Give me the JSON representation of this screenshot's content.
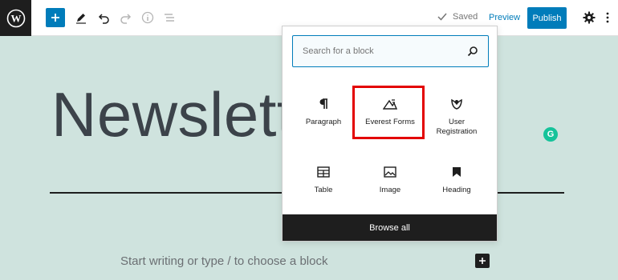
{
  "toolbar": {
    "saved_label": "Saved",
    "preview_label": "Preview",
    "publish_label": "Publish"
  },
  "editor": {
    "title": "Newslette",
    "placeholder": "Start writing or type / to choose a block"
  },
  "inserter": {
    "search_placeholder": "Search for a block",
    "blocks": [
      {
        "label": "Paragraph",
        "icon": "paragraph-icon"
      },
      {
        "label": "Everest Forms",
        "icon": "everest-forms-icon"
      },
      {
        "label": "User Registration",
        "icon": "user-registration-icon"
      },
      {
        "label": "Table",
        "icon": "table-icon"
      },
      {
        "label": "Image",
        "icon": "image-icon"
      },
      {
        "label": "Heading",
        "icon": "heading-icon"
      }
    ],
    "browse_all_label": "Browse all"
  },
  "colors": {
    "accent": "#007cba",
    "canvas": "#cfe3de",
    "highlight": "#e30000",
    "dark": "#1e1e1e"
  }
}
